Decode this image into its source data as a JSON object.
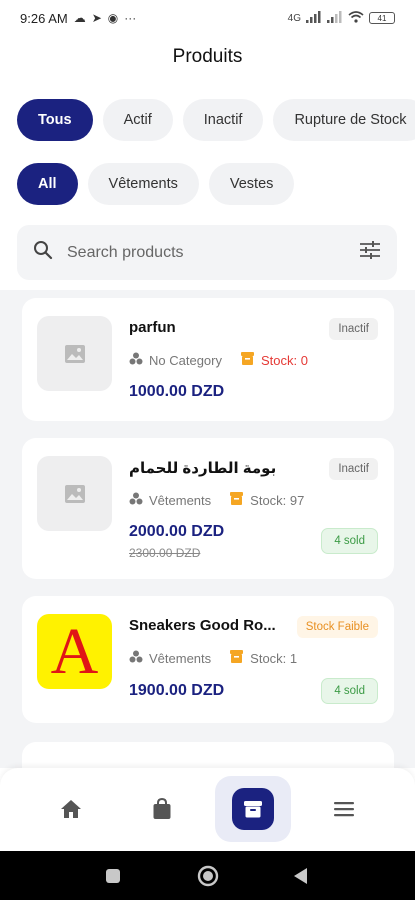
{
  "status_bar": {
    "time": "9:26 AM",
    "icons_left": [
      "cloud-icon",
      "navigation-icon",
      "shazam-icon",
      "more-dots-icon"
    ],
    "more": "···",
    "network_label": "4G",
    "battery": "41"
  },
  "header": {
    "title": "Produits"
  },
  "status_filters": [
    {
      "label": "Tous",
      "active": true
    },
    {
      "label": "Actif",
      "active": false
    },
    {
      "label": "Inactif",
      "active": false
    },
    {
      "label": "Rupture de Stock",
      "active": false
    }
  ],
  "category_filters": [
    {
      "label": "All",
      "active": true
    },
    {
      "label": "Vêtements",
      "active": false
    },
    {
      "label": "Vestes",
      "active": false
    }
  ],
  "search": {
    "placeholder": "Search products"
  },
  "products": [
    {
      "name": "parfun",
      "status": "Inactif",
      "category": "No Category",
      "stock": "Stock: 0",
      "price": "1000.00 DZD"
    },
    {
      "name": "بومة الطاردة للحمام",
      "status": "Inactif",
      "category": "Vêtements",
      "stock": "Stock: 97",
      "price": "2000.00 DZD",
      "old_price": "2300.00 DZD",
      "sold": "4 sold"
    },
    {
      "name": "Sneakers Good Ro...",
      "status": "Stock Faible",
      "category": "Vêtements",
      "stock": "Stock: 1",
      "price": "1900.00 DZD",
      "sold": "4 sold",
      "image_letter": "A"
    }
  ],
  "bottom_nav": [
    {
      "icon": "home-icon",
      "active": false
    },
    {
      "icon": "shopping-bag-icon",
      "active": false
    },
    {
      "icon": "archive-box-icon",
      "active": true
    },
    {
      "icon": "menu-icon",
      "active": false
    }
  ],
  "colors": {
    "primary": "#1b2280",
    "danger": "#e53935",
    "warning": "#e89022",
    "success": "#3c9b46",
    "list_background": "#f3f4f6"
  }
}
